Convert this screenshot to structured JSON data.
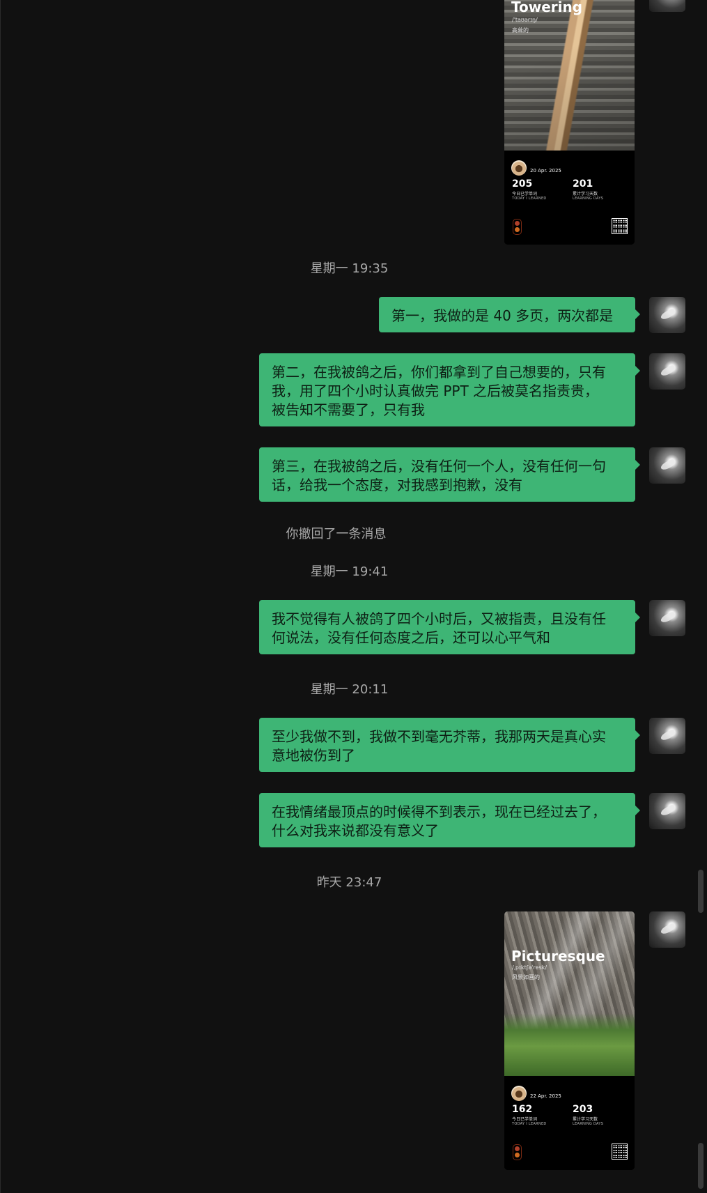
{
  "chat": {
    "messages": [
      {
        "id": "m1",
        "text": "第一，我做的是 40 多页，两次都是"
      },
      {
        "id": "m2",
        "text": "第二，在我被鸽之后，你们都拿到了自己想要的，只有\n我，用了四个小时认真做完 PPT 之后被莫名指责贵，\n被告知不需要了，只有我"
      },
      {
        "id": "m3",
        "text": "第三，在我被鸽之后，没有任何一个人，没有任何一句\n话，给我一个态度，对我感到抱歉，没有"
      },
      {
        "id": "m4",
        "text": "我不觉得有人被鸽了四个小时后，又被指责，且没有任\n何说法，没有任何态度之后，还可以心平气和"
      },
      {
        "id": "m5",
        "text": "至少我做不到，我做不到毫无芥蒂，我那两天是真心实\n意地被伤到了"
      },
      {
        "id": "m6",
        "text": "在我情绪最顶点的时候得不到表示，现在已经过去了，\n什么对我来说都没有意义了"
      }
    ],
    "timestamps": {
      "t1": "星期一 19:35",
      "recall": "你撤回了一条消息",
      "t2": "星期一 19:41",
      "t3": "星期一 20:11",
      "t4": "昨天 23:47"
    },
    "cards": [
      {
        "title": "Towering",
        "phonetic": "/ˈtaʊərɪŋ/",
        "cn": "高耸的",
        "date": "20 Apr. 2025",
        "learned": "205",
        "learned_cn": "今日已学单词",
        "learned_en": "TODAY I LEARNED",
        "days": "201",
        "days_cn": "累计学习天数",
        "days_en": "LEARNING DAYS",
        "photo_colors": [
          "#9ea5a8",
          "#6b6a63",
          "#3f3d38"
        ]
      },
      {
        "title": "Picturesque",
        "phonetic": "/ˌpɪktʃəˈresk/",
        "cn": "风景如画的",
        "date": "22 Apr. 2025",
        "learned": "162",
        "learned_cn": "今日已学单词",
        "learned_en": "TODAY I LEARNED",
        "days": "203",
        "days_cn": "累计学习天数",
        "days_en": "LEARNING DAYS",
        "photo_colors": [
          "#b9c0c4",
          "#6f7a6c",
          "#3f6f2e"
        ]
      }
    ]
  },
  "colors": {
    "background": "#111111",
    "bubble": "#3eb575",
    "timestamp": "#a9a9a9"
  }
}
